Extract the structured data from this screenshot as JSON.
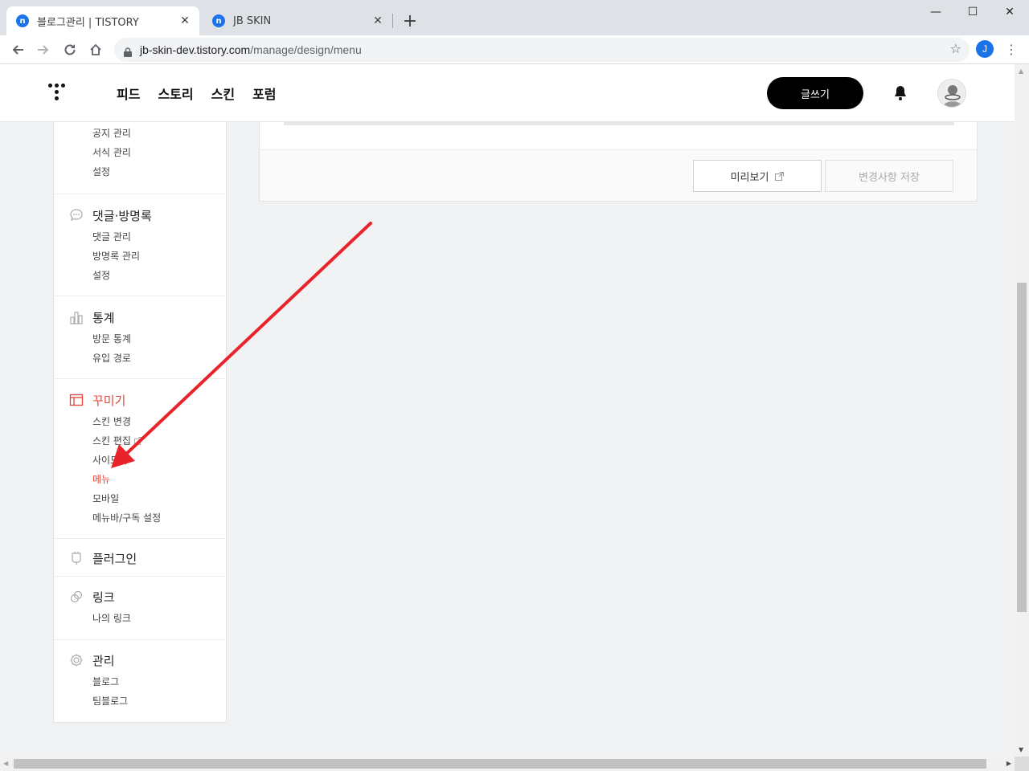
{
  "browser": {
    "tabs": [
      {
        "title": "블로그관리 | TISTORY",
        "favicon": "tistory-icon"
      },
      {
        "title": "JB SKIN",
        "favicon": "tistory-icon"
      }
    ],
    "new_tab": "+",
    "window_controls": {
      "minimize": "—",
      "maximize": "☐",
      "close": "✕"
    },
    "url_host": "jb-skin-dev.tistory.com",
    "url_path": "/manage/design/menu",
    "profile_initial": "J"
  },
  "header": {
    "nav": [
      "피드",
      "스토리",
      "스킨",
      "포럼"
    ],
    "write_button": "글쓰기"
  },
  "sidebar": {
    "top_items": [
      "공지 관리",
      "서식 관리",
      "설정"
    ],
    "sections": [
      {
        "title": "댓글·방명록",
        "icon": "comment-icon",
        "items": [
          "댓글 관리",
          "방명록 관리",
          "설정"
        ]
      },
      {
        "title": "통계",
        "icon": "bar-chart-icon",
        "items": [
          "방문 통계",
          "유입 경로"
        ]
      },
      {
        "title": "꾸미기",
        "icon": "layout-icon",
        "items": [
          "스킨 변경",
          "스킨 편집",
          "사이드바",
          "메뉴",
          "모바일",
          "메뉴바/구독 설정"
        ],
        "active": true,
        "active_item": "메뉴"
      },
      {
        "title": "플러그인",
        "icon": "plugin-icon",
        "items": []
      },
      {
        "title": "링크",
        "icon": "link-icon",
        "items": [
          "나의 링크"
        ]
      },
      {
        "title": "관리",
        "icon": "gear-icon",
        "items": [
          "블로그",
          "팀블로그"
        ]
      }
    ]
  },
  "main": {
    "preview_button": "미리보기",
    "save_button": "변경사항 저장"
  },
  "annotation": {
    "color": "#e8232a"
  },
  "colors": {
    "accent": "#e8443a",
    "black_button": "#000000"
  }
}
